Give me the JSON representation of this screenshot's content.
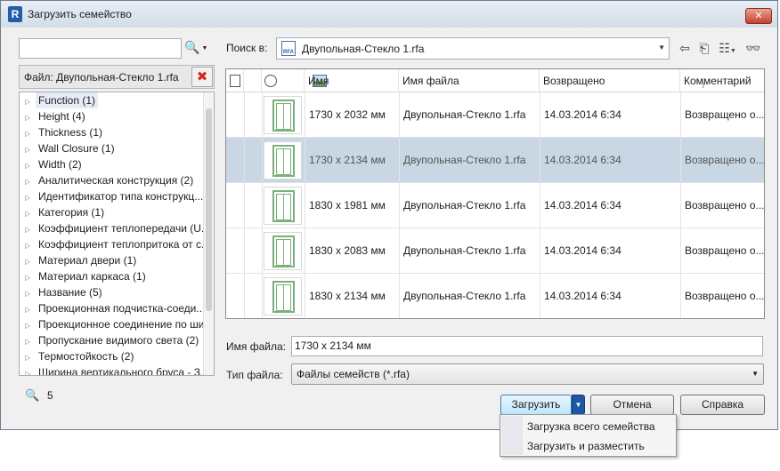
{
  "window": {
    "title": "Загрузить семейство",
    "close_glyph": "✕"
  },
  "left_panel": {
    "search": {
      "value": "",
      "placeholder": ""
    },
    "filter_label": "Файл: Двупольная-Стекло 1.rfa",
    "tree_items": [
      "Function (1)",
      "Height (4)",
      "Thickness (1)",
      "Wall Closure (1)",
      "Width (2)",
      "Аналитическая конструкция (2)",
      "Идентификатор типа конструкц...",
      "Категория (1)",
      "Коэффициент теплопередачи (U...",
      "Коэффициент теплопритока от с...",
      "Материал двери (1)",
      "Материал каркаса (1)",
      "Название (5)",
      "Проекционная подчистка-соеди...",
      "Проекционное соединение по ши...",
      "Пропускание видимого света (2)",
      "Термостойкость (2)",
      "Ширина вертикального бруса - З..."
    ],
    "selected_index": 0,
    "result_count": "5"
  },
  "look_in": {
    "label": "Поиск в:",
    "value": "Двупольная-Стекло 1.rfa",
    "rfa_badge": "RFA"
  },
  "grid": {
    "columns": [
      "Имя",
      "Имя файла",
      "Возвращено",
      "Комментарий"
    ],
    "sort_indicator": "/",
    "selected_row": 1,
    "rows": [
      {
        "name": "1730 x 2032 мм",
        "file": "Двупольная-Стекло 1.rfa",
        "date": "14.03.2014 6:34",
        "comment": "Возвращено о..."
      },
      {
        "name": "1730 x 2134 мм",
        "file": "Двупольная-Стекло 1.rfa",
        "date": "14.03.2014 6:34",
        "comment": "Возвращено о..."
      },
      {
        "name": "1830 x 1981 мм",
        "file": "Двупольная-Стекло 1.rfa",
        "date": "14.03.2014 6:34",
        "comment": "Возвращено о..."
      },
      {
        "name": "1830 x 2083 мм",
        "file": "Двупольная-Стекло 1.rfa",
        "date": "14.03.2014 6:34",
        "comment": "Возвращено о..."
      },
      {
        "name": "1830 x 2134 мм",
        "file": "Двупольная-Стекло 1.rfa",
        "date": "14.03.2014 6:34",
        "comment": "Возвращено о..."
      }
    ]
  },
  "file_name": {
    "label": "Имя файла:",
    "value": "1730 x 2134 мм"
  },
  "file_type": {
    "label": "Тип файла:",
    "value": "Файлы семейств (*.rfa)"
  },
  "buttons": {
    "load": "Загрузить",
    "cancel": "Отмена",
    "help": "Справка"
  },
  "load_menu": [
    "Загрузка всего семейства",
    "Загрузить и разместить"
  ],
  "colors": {
    "selection": "#c9d6e3",
    "accent": "#1e57a4",
    "door_stroke": "#7ab07a"
  }
}
